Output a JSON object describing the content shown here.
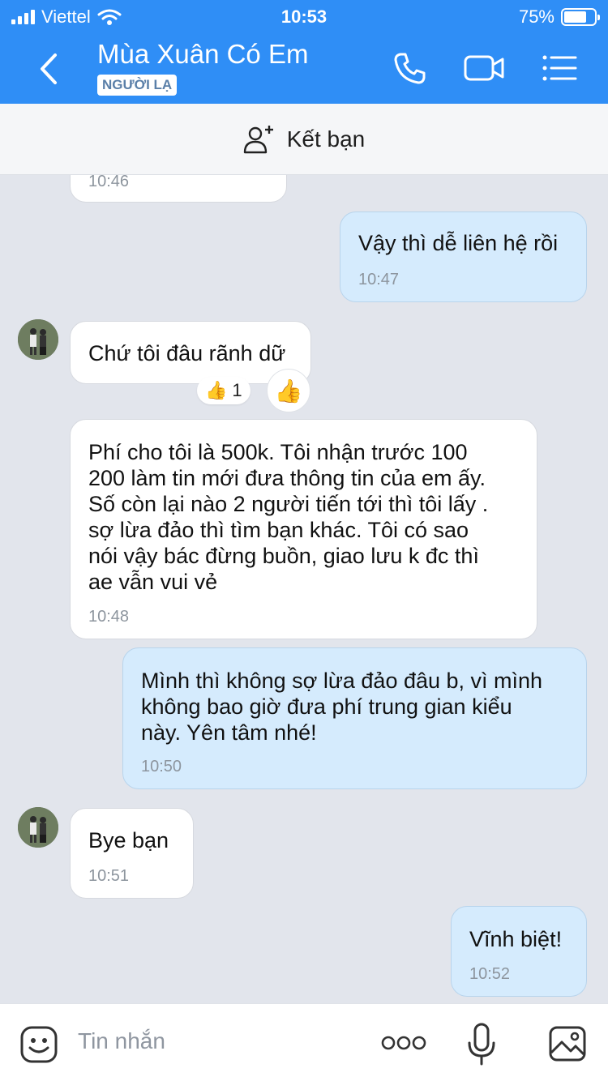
{
  "status_bar": {
    "carrier": "Viettel",
    "time": "10:53",
    "battery": "75%",
    "battery_level": 0.75
  },
  "header": {
    "contact_name": "Mùa Xuân Có Em",
    "badge": "NGƯỜI LẠ",
    "icons": [
      "back-arrow-icon",
      "phone-icon",
      "video-call-icon",
      "menu-list-icon"
    ]
  },
  "friend_bar": {
    "label": "Kết bạn",
    "icon": "add-friend-icon"
  },
  "messages": [
    {
      "direction": "in",
      "text": "",
      "time": "10:46"
    },
    {
      "direction": "out",
      "text": "Vậy thì dễ liên hệ rồi",
      "time": "10:47"
    },
    {
      "direction": "in",
      "text": "Chứ tôi đâu rãnh dữ",
      "time": "",
      "reaction": {
        "emoji": "👍",
        "count": "1"
      }
    },
    {
      "direction": "in",
      "lines": [
        "Phí cho tôi là 500k. Tôi nhận trước 100",
        "200 làm tin mới đưa thông tin của em ấy.",
        "Số còn lại nào 2 người tiến tới thì tôi lấy .",
        "sợ lừa đảo thì tìm bạn khác. Tôi có sao",
        "nói vậy bác đừng buồn, giao lưu k đc thì",
        "ae vẫn vui vẻ"
      ],
      "time": "10:48"
    },
    {
      "direction": "out",
      "lines": [
        "Mình thì không sợ lừa đảo đâu b, vì mình",
        "không bao giờ đưa phí trung gian kiểu",
        "này. Yên tâm nhé!"
      ],
      "time": "10:50"
    },
    {
      "direction": "in",
      "text": "Bye bạn",
      "time": "10:51"
    },
    {
      "direction": "out",
      "text": "Vĩnh biệt!",
      "time": "10:52"
    }
  ],
  "input_bar": {
    "placeholder": "Tin nhắn",
    "icons": [
      "sticker-icon",
      "more-icon",
      "microphone-icon",
      "image-icon"
    ]
  },
  "colors": {
    "header_bg": "#2f8ef6",
    "chat_bg": "#e2e5ec",
    "incoming_bubble": "#ffffff",
    "outgoing_bubble": "#d5ebfd"
  }
}
